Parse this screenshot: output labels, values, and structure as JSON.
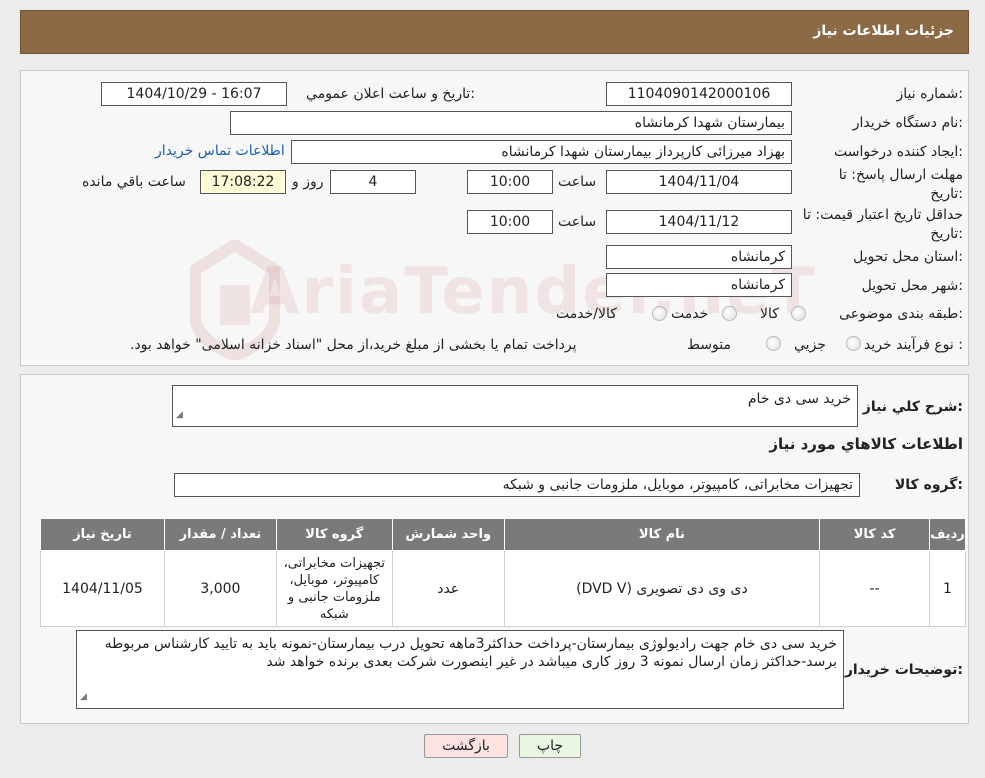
{
  "header": {
    "title": "جزئیات اطلاعات نیاز"
  },
  "form": {
    "need_number_label": "شماره نیاز:",
    "need_number": "1104090142000106",
    "announce_label": "تاریخ و ساعت اعلان عمومي:",
    "announce_value": "1404/10/29 - 16:07",
    "buyer_org_label": "نام دستگاه خريدار:",
    "buyer_org": "بیمارستان شهدا کرمانشاه",
    "requester_label": "ايجاد کننده درخواست:",
    "requester": "بهزاد میرزائی کارپرداز بیمارستان شهدا کرمانشاه",
    "contact_link": "اطلاعات تماس خريدار",
    "deadline_label_1": "مهلت ارسال پاسخ: تا",
    "deadline_label_2": "تاريخ:",
    "deadline_date": "1404/11/04",
    "time_label": "ساعت",
    "deadline_time": "10:00",
    "days_value": "4",
    "days_label": "روز و",
    "remaining_time": "17:08:22",
    "remaining_label": "ساعت باقي مانده",
    "validity_label_1": "حداقل تاريخ اعتبار قيمت: تا",
    "validity_label_2": "تاريخ:",
    "validity_date": "1404/11/12",
    "validity_time": "10:00",
    "province_label": "استان محل تحويل:",
    "province": "کرمانشاه",
    "city_label": "شهر محل تحويل:",
    "city": "کرمانشاه",
    "category_label": "طبقه بندی موضوعی:",
    "category_options": [
      "کالا",
      "خدمت",
      "کالا/خدمت"
    ],
    "process_label": "نوع فرآيند خريد :",
    "process_options": [
      "جزيي",
      "متوسط"
    ],
    "process_note": "پرداخت تمام یا بخشی از مبلغ خرید،از محل \"اسناد خزانه اسلامی\" خواهد بود."
  },
  "details": {
    "general_desc_label": "شرح کلي نياز:",
    "general_desc": "خرید سی دی خام",
    "items_title": "اطلاعات کالاهاي مورد نياز",
    "goods_group_label": "گروه کالا:",
    "goods_group": "تجهیزات مخابراتی، کامپیوتر، موبایل، ملزومات جانبی و شبکه",
    "table": {
      "headers": [
        "رديف",
        "کد کالا",
        "نام کالا",
        "واحد شمارش",
        "گروه کالا",
        "تعداد / مقدار",
        "تاريخ نياز"
      ],
      "rows": [
        [
          "1",
          "--",
          "دی وی دی تصویری (DVD V)",
          "عدد",
          "تجهیزات مخابراتی، کامپیوتر، موبایل، ملزومات جانبی و شبکه",
          "3,000",
          "1404/11/05"
        ]
      ]
    },
    "buyer_notes_label": "توضيحات خريدار:",
    "buyer_notes": "خرید سی دی خام جهت رادیولوژی بیمارستان-پرداخت حداکثر3ماهه تحویل درب بیمارستان-نمونه باید به تایید کارشناس مربوطه برسد-حداکثر زمان ارسال نمونه 3 روز کاری میباشد در غیر اینصورت شرکت بعدی برنده خواهد شد"
  },
  "buttons": {
    "print": "چاپ",
    "back": "بازگشت"
  },
  "colors": {
    "header_bg": "#8b6a45",
    "table_header_bg": "#7a7a7a",
    "back_btn_bg": "#fde2e2",
    "print_btn_bg": "#e8f6e2"
  }
}
